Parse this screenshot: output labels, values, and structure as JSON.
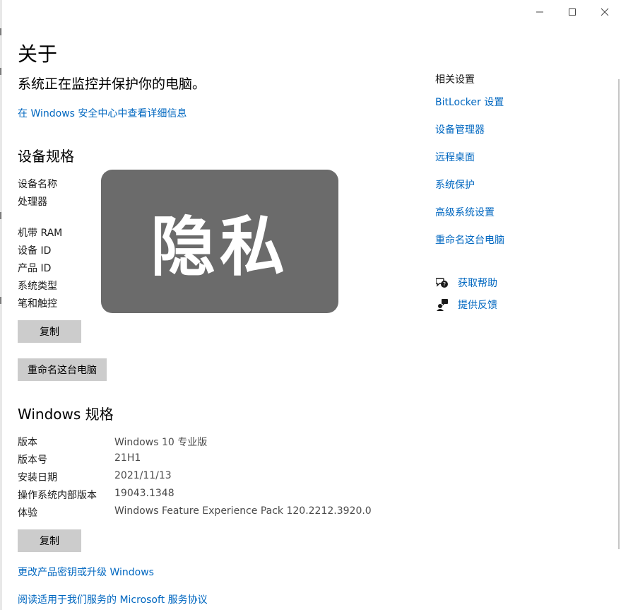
{
  "window": {
    "minimize": "—",
    "maximize": "☐",
    "close": "✕"
  },
  "page": {
    "title": "关于",
    "protect_text": "系统正在监控并保护你的电脑。",
    "protect_link": "在 Windows 安全中心中查看详细信息"
  },
  "device_specs": {
    "title": "设备规格",
    "labels": {
      "device_name": "设备名称",
      "processor": "处理器",
      "ram": "机带 RAM",
      "device_id": "设备 ID",
      "product_id": "产品 ID",
      "system_type": "系统类型",
      "pen_touch": "笔和触控"
    },
    "copy_button": "复制",
    "rename_button": "重命名这台电脑"
  },
  "privacy_mask": {
    "text": "隐私"
  },
  "windows_specs": {
    "title": "Windows 规格",
    "rows": [
      {
        "label": "版本",
        "value": "Windows 10 专业版"
      },
      {
        "label": "版本号",
        "value": "21H1"
      },
      {
        "label": "安装日期",
        "value": "2021/11/13"
      },
      {
        "label": "操作系统内部版本",
        "value": "19043.1348"
      },
      {
        "label": "体验",
        "value": "Windows Feature Experience Pack 120.2212.3920.0"
      }
    ],
    "copy_button": "复制",
    "link_product_key": "更改产品密钥或升级 Windows",
    "link_service_agreement": "阅读适用于我们服务的 Microsoft 服务协议"
  },
  "related_settings": {
    "title": "相关设置",
    "links": [
      "BitLocker 设置",
      "设备管理器",
      "远程桌面",
      "系统保护",
      "高级系统设置",
      "重命名这台电脑"
    ]
  },
  "help": {
    "get_help": "获取帮助",
    "feedback": "提供反馈"
  },
  "colors": {
    "link": "#0067c0",
    "button": "#cccccc",
    "mask": "#6b6b6b"
  },
  "icons": {
    "get_help": "help-chat-icon",
    "feedback": "feedback-icon"
  }
}
